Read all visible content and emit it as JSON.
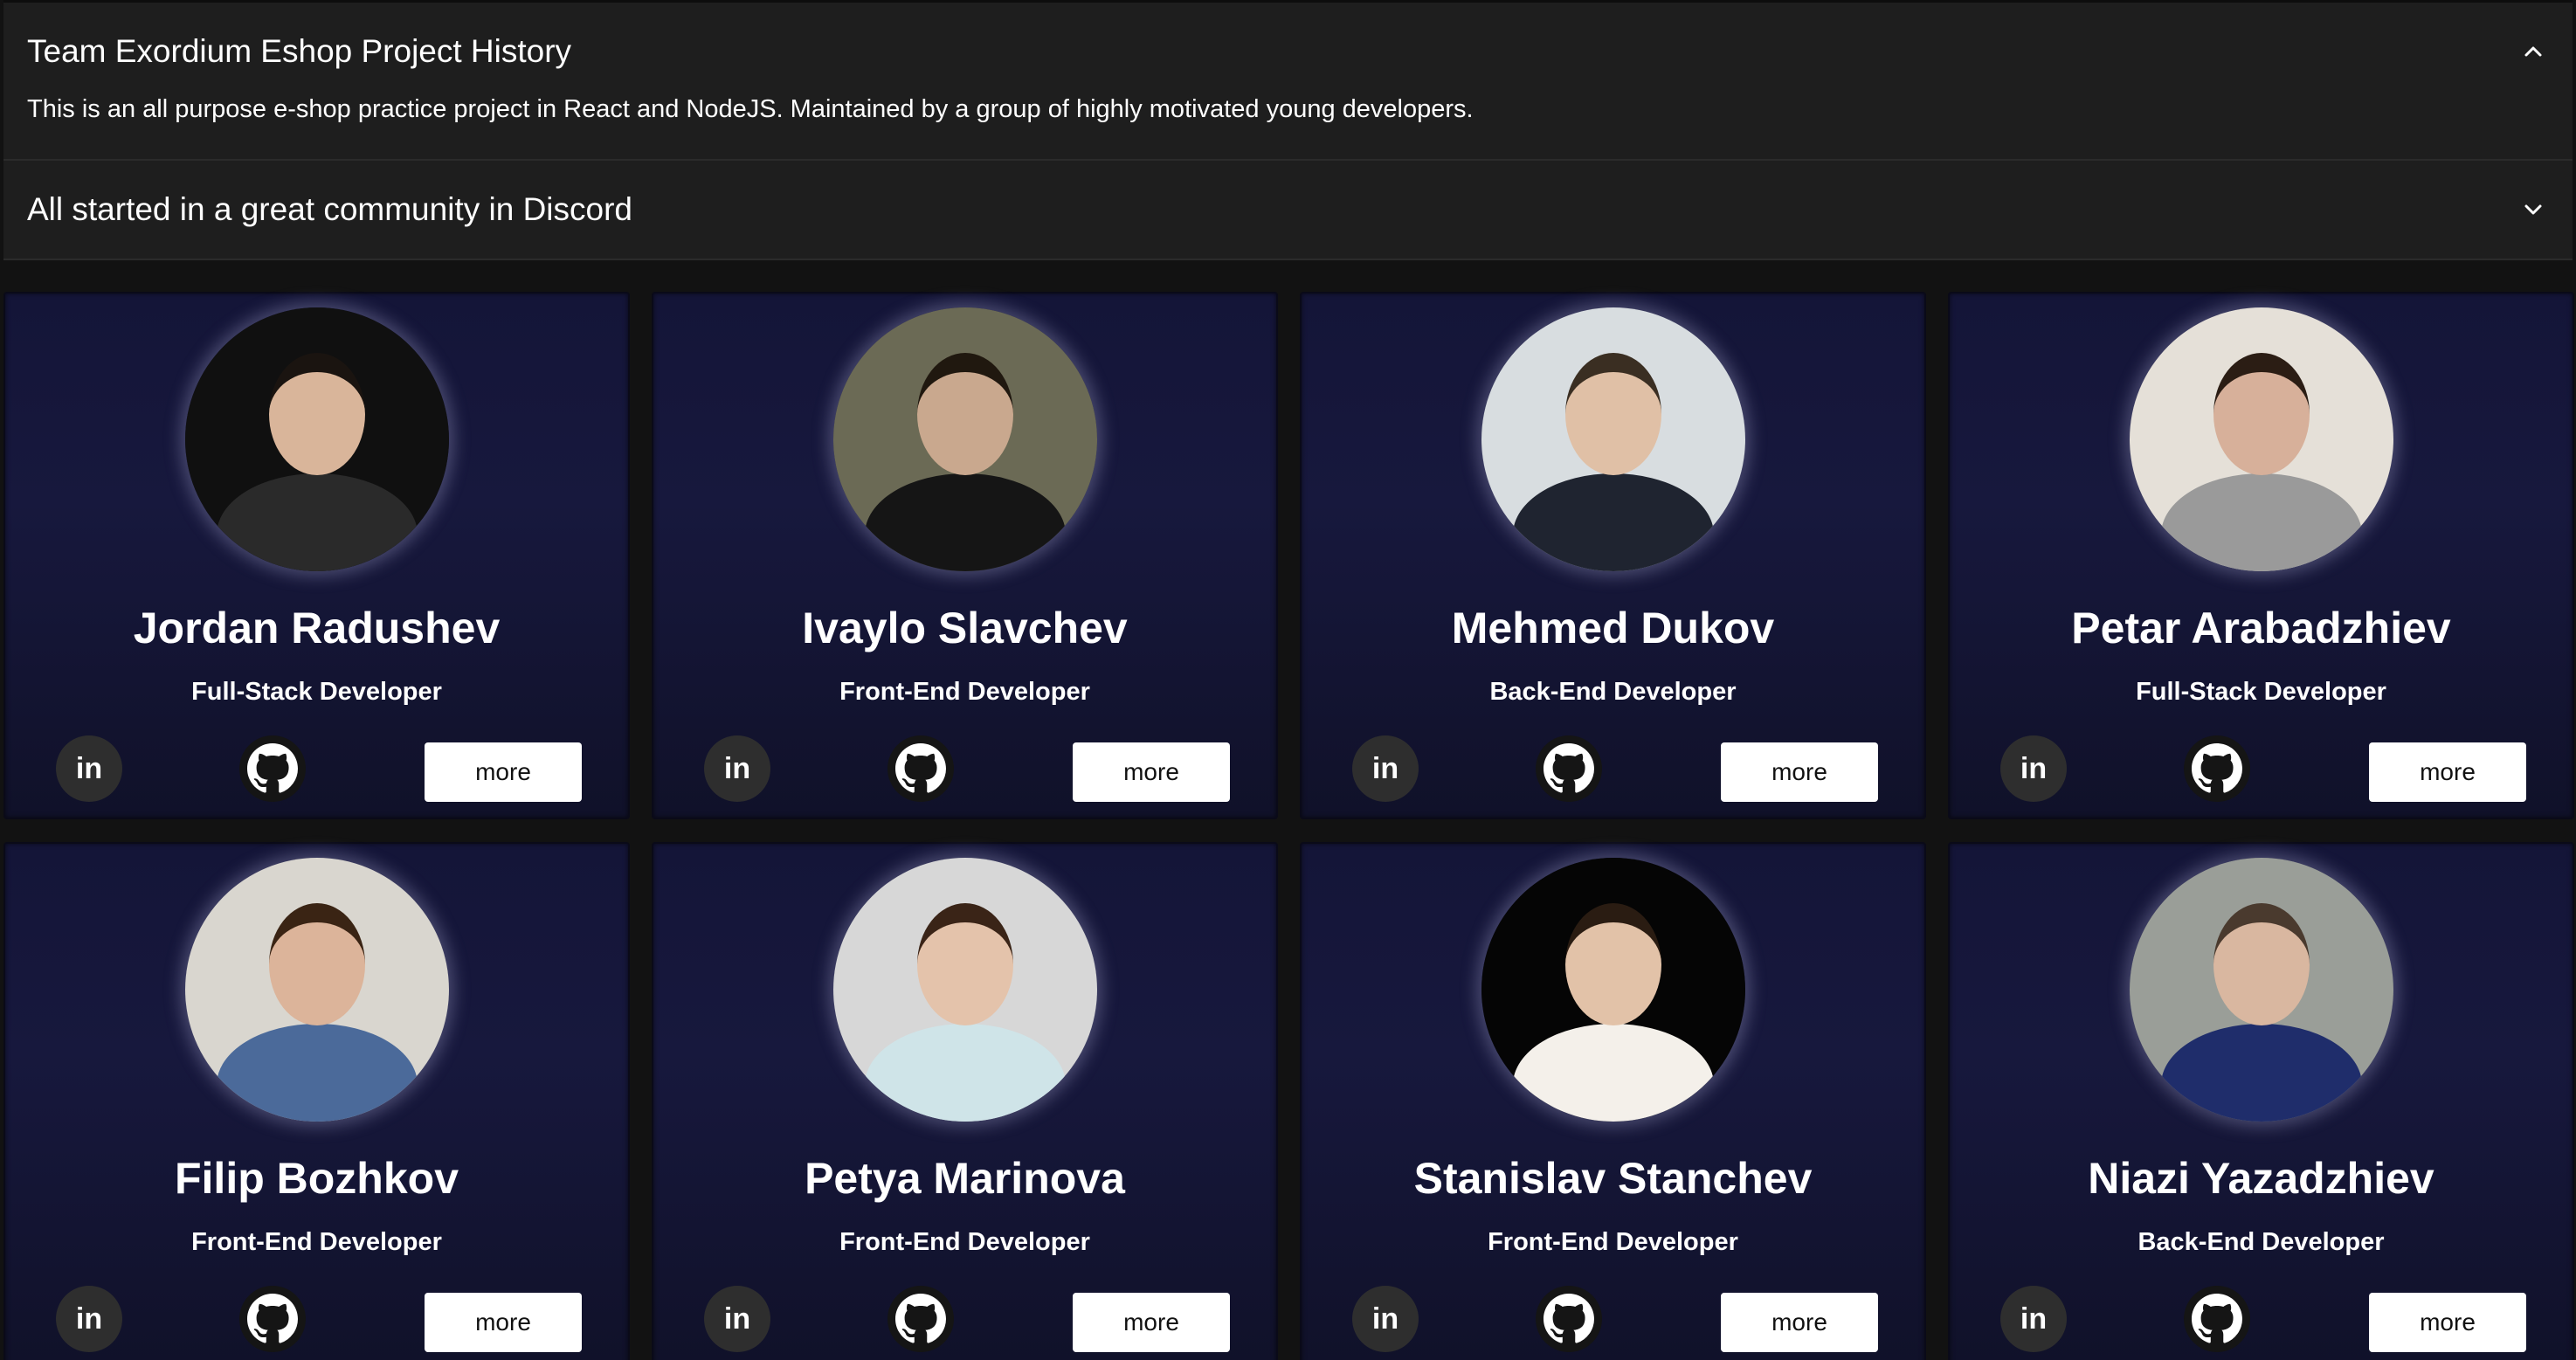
{
  "accordion": {
    "items": [
      {
        "title": "Team Exordium Eshop Project History",
        "expanded": true,
        "details": "This is an all purpose e-shop practice project in React and NodeJS. Maintained by a group of highly motivated young developers."
      },
      {
        "title": "All started in a great community in Discord",
        "expanded": false
      }
    ]
  },
  "team": [
    {
      "name": "Jordan Radushev",
      "role": "Full-Stack Developer",
      "more_label": "more",
      "linkedin_label": "in"
    },
    {
      "name": "Ivaylo Slavchev",
      "role": "Front-End Developer",
      "more_label": "more",
      "linkedin_label": "in"
    },
    {
      "name": "Mehmed Dukov",
      "role": "Back-End Developer",
      "more_label": "more",
      "linkedin_label": "in"
    },
    {
      "name": "Petar Arabadzhiev",
      "role": "Full-Stack Developer",
      "more_label": "more",
      "linkedin_label": "in"
    },
    {
      "name": "Filip Bozhkov",
      "role": "Front-End Developer",
      "more_label": "more",
      "linkedin_label": "in"
    },
    {
      "name": "Petya Marinova",
      "role": "Front-End Developer",
      "more_label": "more",
      "linkedin_label": "in"
    },
    {
      "name": "Stanislav Stanchev",
      "role": "Front-End Developer",
      "more_label": "more",
      "linkedin_label": "in"
    },
    {
      "name": "Niazi Yazadzhiev",
      "role": "Back-End Developer",
      "more_label": "more",
      "linkedin_label": "in"
    }
  ],
  "colors": {
    "page_bg": "#121212",
    "accordion_bg": "#1e1e1e",
    "card_bg": "#15163a",
    "text": "#ffffff"
  },
  "icons": {
    "expanded": "chevron-up-icon",
    "collapsed": "chevron-down-icon",
    "linkedin": "linkedin-icon",
    "github": "github-icon"
  }
}
